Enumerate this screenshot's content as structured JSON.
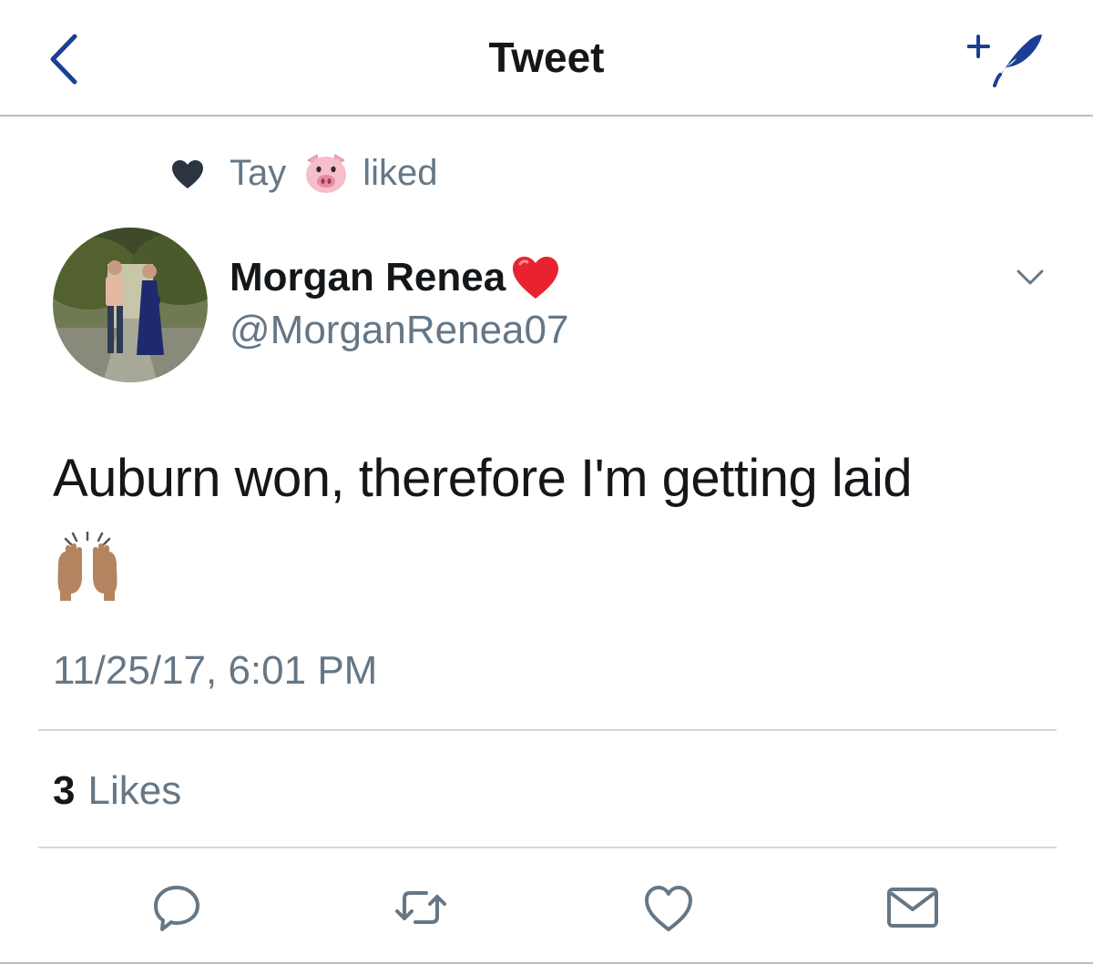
{
  "header": {
    "title": "Tweet",
    "back_icon": "chevron-left-icon",
    "compose_icon": "compose-feather-icon",
    "accent": "#1c3f95"
  },
  "social_context": {
    "user": "Tay",
    "user_emoji": "pig-face-emoji",
    "action": "liked",
    "icon": "heart-icon"
  },
  "author": {
    "name": "Morgan Renea",
    "name_emoji": "red-heart-emoji",
    "handle": "@MorganRenea07"
  },
  "tweet": {
    "text": "Auburn won, therefore I'm getting laid",
    "emoji": "raising-hands-emoji",
    "timestamp": "11/25/17, 6:01 PM"
  },
  "stats": {
    "likes_count": "3",
    "likes_label": "Likes"
  },
  "actions": [
    {
      "name": "reply",
      "icon": "reply-bubble-icon"
    },
    {
      "name": "retweet",
      "icon": "retweet-icon"
    },
    {
      "name": "like",
      "icon": "heart-outline-icon"
    },
    {
      "name": "direct-message",
      "icon": "envelope-icon"
    }
  ],
  "colors": {
    "primary_text": "#14171a",
    "secondary_text": "#657786",
    "icon_gray": "#657786",
    "divider": "#d6d6d6"
  }
}
